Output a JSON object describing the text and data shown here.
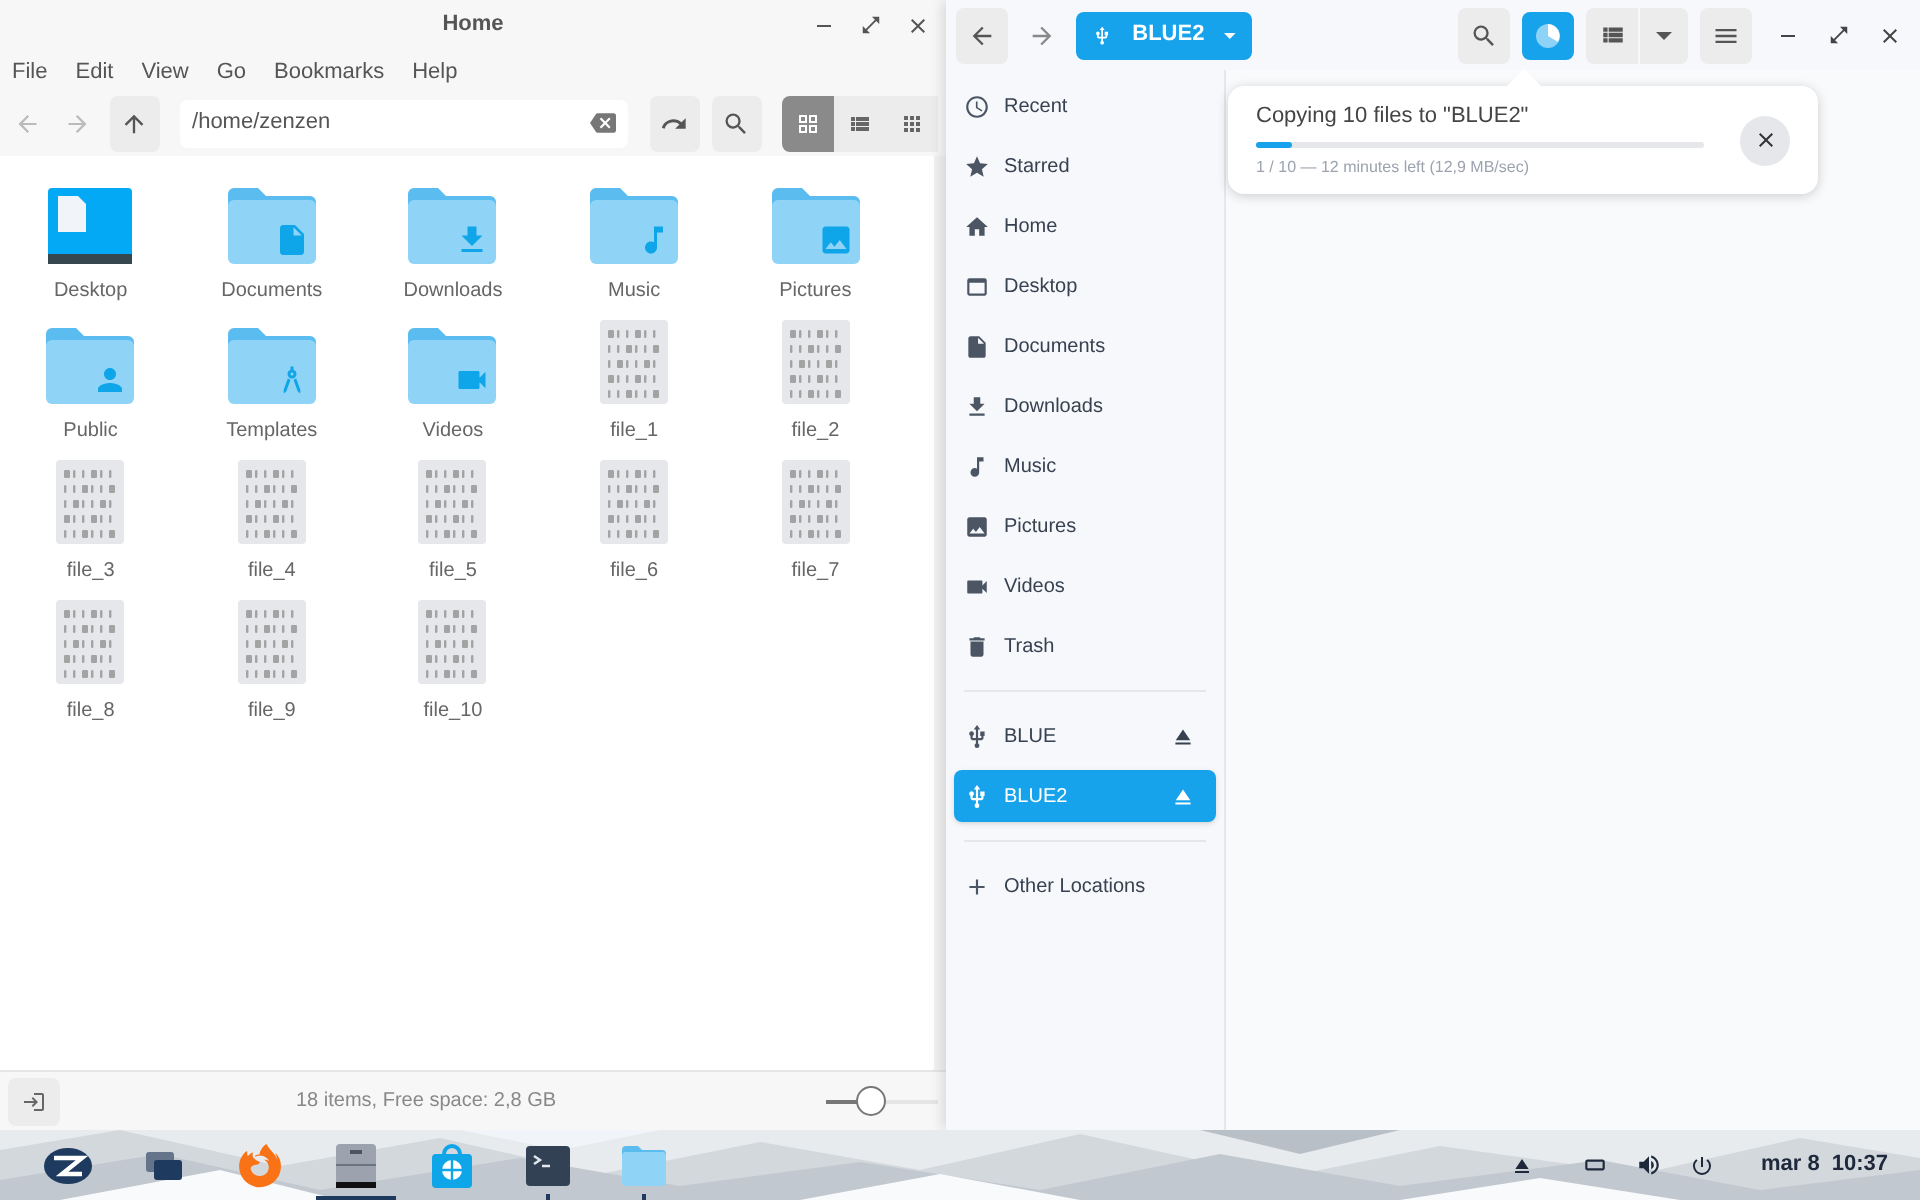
{
  "left_window": {
    "title": "Home",
    "menu": [
      "File",
      "Edit",
      "View",
      "Go",
      "Bookmarks",
      "Help"
    ],
    "path": "/home/zenzen",
    "view_modes": [
      {
        "selected": true
      },
      {
        "selected": false
      },
      {
        "selected": false
      }
    ],
    "items": [
      {
        "label": "Desktop",
        "kind": "desktop"
      },
      {
        "label": "Documents",
        "kind": "folder"
      },
      {
        "label": "Downloads",
        "kind": "folder"
      },
      {
        "label": "Music",
        "kind": "folder"
      },
      {
        "label": "Pictures",
        "kind": "folder"
      },
      {
        "label": "Public",
        "kind": "folder"
      },
      {
        "label": "Templates",
        "kind": "folder"
      },
      {
        "label": "Videos",
        "kind": "folder"
      },
      {
        "label": "file_1",
        "kind": "file"
      },
      {
        "label": "file_2",
        "kind": "file"
      },
      {
        "label": "file_3",
        "kind": "file"
      },
      {
        "label": "file_4",
        "kind": "file"
      },
      {
        "label": "file_5",
        "kind": "file"
      },
      {
        "label": "file_6",
        "kind": "file"
      },
      {
        "label": "file_7",
        "kind": "file"
      },
      {
        "label": "file_8",
        "kind": "file"
      },
      {
        "label": "file_9",
        "kind": "file"
      },
      {
        "label": "file_10",
        "kind": "file"
      }
    ],
    "status": "18 items, Free space: 2,8 GB",
    "zoom": {
      "level": 0.4
    }
  },
  "right_window": {
    "location": "BLUE2",
    "sidebar": [
      {
        "label": "Recent",
        "kind": "place",
        "selected": false
      },
      {
        "label": "Starred",
        "kind": "place",
        "selected": false
      },
      {
        "label": "Home",
        "kind": "place",
        "selected": false
      },
      {
        "label": "Desktop",
        "kind": "place",
        "selected": false
      },
      {
        "label": "Documents",
        "kind": "place",
        "selected": false
      },
      {
        "label": "Downloads",
        "kind": "place",
        "selected": false
      },
      {
        "label": "Music",
        "kind": "place",
        "selected": false
      },
      {
        "label": "Pictures",
        "kind": "place",
        "selected": false
      },
      {
        "label": "Videos",
        "kind": "place",
        "selected": false
      },
      {
        "label": "Trash",
        "kind": "place",
        "selected": false
      },
      {
        "label": "BLUE",
        "kind": "device",
        "selected": false
      },
      {
        "label": "BLUE2",
        "kind": "device",
        "selected": true
      },
      {
        "label": "Other Locations",
        "kind": "action",
        "selected": false
      }
    ],
    "operation": {
      "title": "Copying 10 files to \"BLUE2\"",
      "level": 0.08,
      "detail": "1 / 10 — 12 minutes left (12,9 MB/sec)"
    }
  },
  "taskbar": {
    "apps": [
      {
        "running": false,
        "focused": false
      },
      {
        "running": false,
        "focused": false
      },
      {
        "running": false,
        "focused": false
      },
      {
        "running": true,
        "focused": true
      },
      {
        "running": false,
        "focused": false
      },
      {
        "running": true,
        "focused": false
      },
      {
        "running": true,
        "focused": false
      }
    ],
    "date": "mar 8",
    "time": "10:37"
  }
}
